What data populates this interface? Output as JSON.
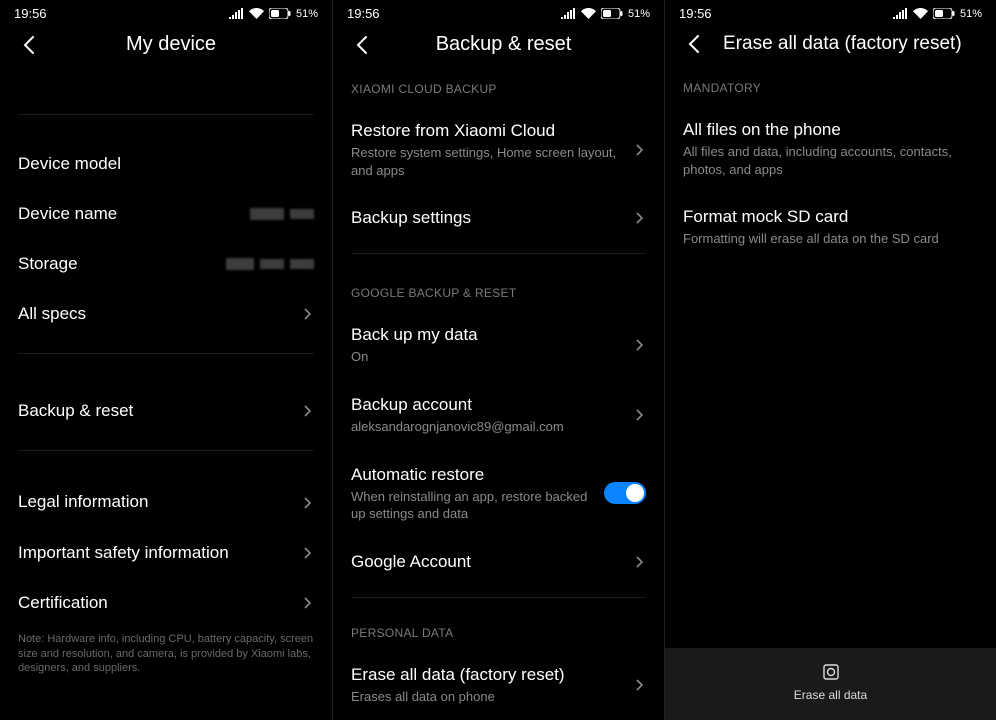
{
  "status": {
    "time": "19:56",
    "battery_pct": "51%"
  },
  "panel1": {
    "title": "My device",
    "rows": {
      "device_model": {
        "label": "Device model",
        "value": ""
      },
      "device_name": {
        "label": "Device name"
      },
      "storage": {
        "label": "Storage"
      },
      "all_specs": {
        "label": "All specs"
      },
      "backup_reset": {
        "label": "Backup & reset"
      },
      "legal": {
        "label": "Legal information"
      },
      "safety": {
        "label": "Important safety information"
      },
      "certification": {
        "label": "Certification"
      }
    },
    "note": "Note: Hardware info, including CPU, battery capacity, screen size and resolution, and camera, is provided by Xiaomi labs, designers, and suppliers."
  },
  "panel2": {
    "title": "Backup & reset",
    "sections": {
      "xiaomi": "XIAOMI CLOUD BACKUP",
      "google": "GOOGLE BACKUP & RESET",
      "personal": "PERSONAL DATA"
    },
    "rows": {
      "restore_xiaomi": {
        "label": "Restore from Xiaomi Cloud",
        "sub": "Restore system settings, Home screen layout, and apps"
      },
      "backup_settings": {
        "label": "Backup settings"
      },
      "backup_my_data": {
        "label": "Back up my data",
        "sub": "On"
      },
      "backup_account": {
        "label": "Backup account",
        "sub": "aleksandarognjanovic89@gmail.com"
      },
      "auto_restore": {
        "label": "Automatic restore",
        "sub": "When reinstalling an app, restore backed up settings and data",
        "toggle": true
      },
      "google_account": {
        "label": "Google Account"
      },
      "erase_all": {
        "label": "Erase all data (factory reset)",
        "sub": "Erases all data on phone"
      }
    }
  },
  "panel3": {
    "title": "Erase all data (factory reset)",
    "section": "MANDATORY",
    "rows": {
      "all_files": {
        "label": "All files on the phone",
        "sub": "All files and data, including accounts, contacts, photos, and apps"
      },
      "format_sd": {
        "label": "Format mock SD card",
        "sub": "Formatting will erase all data on the SD card"
      }
    },
    "button": "Erase all data"
  }
}
